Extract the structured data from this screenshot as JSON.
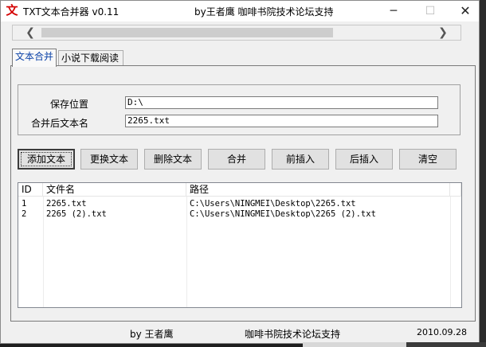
{
  "window": {
    "title": "TXT文本合并器 v0.11",
    "subtitle": "by王者鹰 咖啡书院技术论坛支持",
    "icon": "red-wen-glyph",
    "minimize": "─",
    "maximize": "☐",
    "close": "✕"
  },
  "scrollbar": {
    "left": "❮",
    "right": "❯"
  },
  "tabs": [
    {
      "label": "文本合并",
      "active": true
    },
    {
      "label": "小说下载阅读",
      "active": false
    }
  ],
  "form": {
    "save_location_label": "保存位置",
    "save_location_value": "D:\\",
    "merged_name_label": "合并后文本名",
    "merged_name_value": "2265.txt"
  },
  "buttons": {
    "add": "添加文本",
    "replace": "更换文本",
    "delete": "删除文本",
    "merge": "合并",
    "insert_before": "前插入",
    "insert_after": "后插入",
    "clear": "清空"
  },
  "list": {
    "columns": [
      "ID",
      "文件名",
      "路径"
    ],
    "rows": [
      {
        "id": "1",
        "name": "2265.txt",
        "path": "C:\\Users\\NINGMEI\\Desktop\\2265.txt"
      },
      {
        "id": "2",
        "name": "2265 (2).txt",
        "path": "C:\\Users\\NINGMEI\\Desktop\\2265 (2).txt"
      }
    ]
  },
  "status": {
    "author": "by 王者鹰",
    "support": "咖啡书院技术论坛支持",
    "date": "2010.09.28"
  },
  "colors": {
    "accent_tab": "#0d43a8",
    "icon_red": "#d40000",
    "window_bg": "#f0f0f0"
  }
}
